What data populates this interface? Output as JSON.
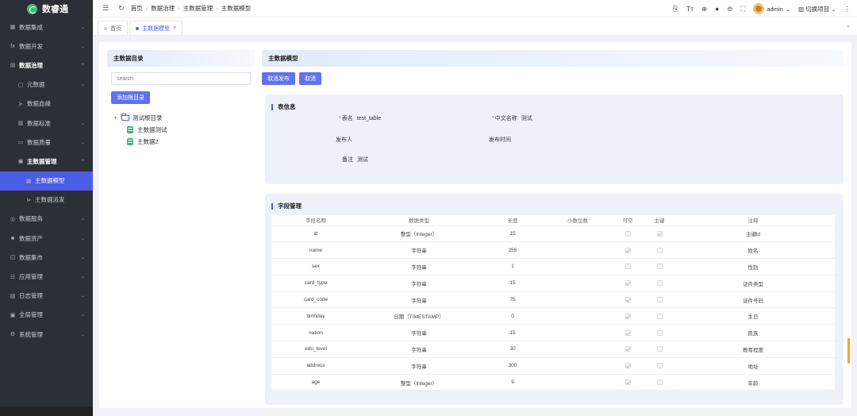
{
  "app": {
    "name": "数睿通"
  },
  "sidebar": {
    "items": [
      {
        "icon": "grid-icon",
        "glyph": "▦",
        "label": "数据集成",
        "level": 0,
        "arrow": "⌄",
        "open": false,
        "active": false
      },
      {
        "icon": "function-icon",
        "glyph": "fx",
        "label": "数据开发",
        "level": 0,
        "arrow": "⌄",
        "open": false,
        "active": false
      },
      {
        "icon": "table-icon",
        "glyph": "▤",
        "label": "数据治理",
        "level": 0,
        "arrow": "⌃",
        "open": true,
        "active": false
      },
      {
        "icon": "document-icon",
        "glyph": "▢",
        "label": "元数据",
        "level": 1,
        "arrow": "⌄",
        "open": false,
        "active": false
      },
      {
        "icon": "lineage-icon",
        "glyph": "⊱",
        "label": "数据血缘",
        "level": 1,
        "arrow": "",
        "open": false,
        "active": false
      },
      {
        "icon": "standard-icon",
        "glyph": "▥",
        "label": "数据标准",
        "level": 1,
        "arrow": "⌄",
        "open": false,
        "active": false
      },
      {
        "icon": "quality-icon",
        "glyph": "▭",
        "label": "数据质量",
        "level": 1,
        "arrow": "⌄",
        "open": false,
        "active": false
      },
      {
        "icon": "master-data-icon",
        "glyph": "▣",
        "label": "主数据管理",
        "level": 1,
        "arrow": "⌃",
        "open": true,
        "active": false
      },
      {
        "icon": "model-icon",
        "glyph": "▦",
        "label": "主数据模型",
        "level": 2,
        "arrow": "",
        "open": false,
        "active": true
      },
      {
        "icon": "distribute-icon",
        "glyph": "⊳",
        "label": "主数据派发",
        "level": 2,
        "arrow": "",
        "open": false,
        "active": false
      },
      {
        "icon": "service-icon",
        "glyph": "◎",
        "label": "数据服务",
        "level": 0,
        "arrow": "⌄",
        "open": false,
        "active": false
      },
      {
        "icon": "asset-icon",
        "glyph": "■",
        "label": "数据资产",
        "level": 0,
        "arrow": "⌄",
        "open": false,
        "active": false
      },
      {
        "icon": "market-icon",
        "glyph": "◰",
        "label": "数据集市",
        "level": 0,
        "arrow": "⌄",
        "open": false,
        "active": false
      },
      {
        "icon": "app-icon",
        "glyph": "☷",
        "label": "应用管理",
        "level": 0,
        "arrow": "⌄",
        "open": false,
        "active": false
      },
      {
        "icon": "log-icon",
        "glyph": "▤",
        "label": "日志管理",
        "level": 0,
        "arrow": "⌄",
        "open": false,
        "active": false
      },
      {
        "icon": "global-icon",
        "glyph": "▣",
        "label": "全局管理",
        "level": 0,
        "arrow": "⌄",
        "open": false,
        "active": false
      },
      {
        "icon": "settings-icon",
        "glyph": "⚙",
        "label": "系统管理",
        "level": 0,
        "arrow": "⌄",
        "open": false,
        "active": false
      }
    ]
  },
  "topbar": {
    "breadcrumb": [
      "首页",
      "数据治理",
      "主数据管理",
      "主数据模型"
    ],
    "user": "admin",
    "switch_project": "切换项目"
  },
  "tabs": [
    {
      "label": "首页",
      "active": false
    },
    {
      "label": "主数据模型",
      "active": true
    }
  ],
  "left_panel": {
    "title": "主数据目录",
    "search_placeholder": "search",
    "add_root_label": "添加根目录",
    "tree": {
      "root": "测试根目录",
      "children": [
        "主数据测试",
        "主数据2"
      ]
    }
  },
  "right_panel": {
    "title": "主数据模型",
    "actions": {
      "unpublish": "取消发布",
      "cancel": "取消"
    },
    "table_info": {
      "title": "表信息",
      "fields": {
        "table_name_label": "表名",
        "table_name_value": "test_table",
        "cn_name_label": "中文名称",
        "cn_name_value": "测试",
        "publisher_label": "发布人",
        "publish_time_label": "发布时间",
        "remark_label": "备注",
        "remark_value": "测试"
      }
    },
    "field_mgmt": {
      "title": "字段管理",
      "columns": [
        "字段名称",
        "数据类型",
        "长度",
        "小数位数",
        "可空",
        "主键",
        "注释"
      ],
      "rows": [
        {
          "name": "id",
          "type": "整型（Integer）",
          "length": "15",
          "decimals": "",
          "nullable": false,
          "pk": true,
          "comment": "主键id"
        },
        {
          "name": "name",
          "type": "字符串",
          "length": "255",
          "decimals": "",
          "nullable": true,
          "pk": false,
          "comment": "姓名"
        },
        {
          "name": "sex",
          "type": "字符串",
          "length": "1",
          "decimals": "",
          "nullable": false,
          "pk": false,
          "comment": "性别"
        },
        {
          "name": "card_type",
          "type": "字符串",
          "length": "15",
          "decimals": "",
          "nullable": true,
          "pk": false,
          "comment": "证件类型"
        },
        {
          "name": "card_code",
          "type": "字符串",
          "length": "75",
          "decimals": "",
          "nullable": true,
          "pk": false,
          "comment": "证件号码"
        },
        {
          "name": "birthday",
          "type": "日期（TIMESTAMP）",
          "length": "0",
          "decimals": "",
          "nullable": true,
          "pk": false,
          "comment": "生日"
        },
        {
          "name": "nation",
          "type": "字符串",
          "length": "15",
          "decimals": "",
          "nullable": true,
          "pk": false,
          "comment": "民族"
        },
        {
          "name": "edu_level",
          "type": "字符串",
          "length": "30",
          "decimals": "",
          "nullable": true,
          "pk": false,
          "comment": "教育程度"
        },
        {
          "name": "address",
          "type": "字符串",
          "length": "300",
          "decimals": "",
          "nullable": true,
          "pk": false,
          "comment": "地址"
        },
        {
          "name": "age",
          "type": "整型（Integer）",
          "length": "9",
          "decimals": "",
          "nullable": true,
          "pk": false,
          "comment": "年龄"
        }
      ]
    }
  }
}
